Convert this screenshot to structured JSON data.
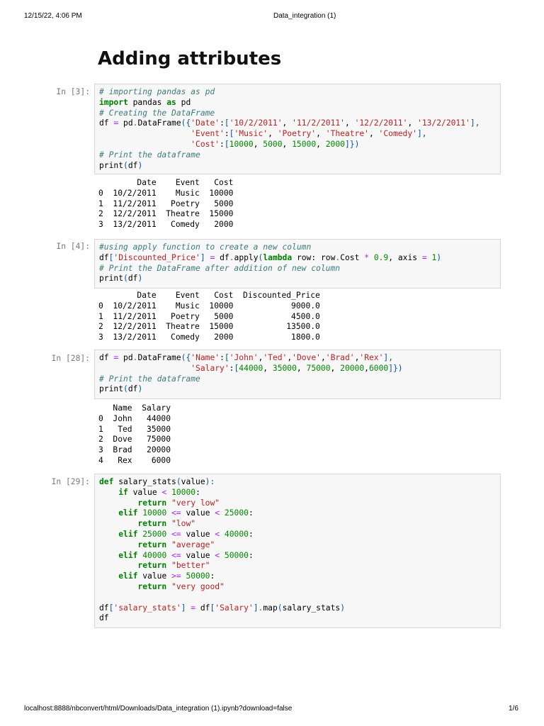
{
  "header": {
    "datetime": "12/15/22, 4:06 PM",
    "title": "Data_integration (1)"
  },
  "footer": {
    "url": "localhost:8888/nbconvert/html/Downloads/Data_integration (1).ipynb?download=false",
    "page": "1/6"
  },
  "heading": "Adding attributes",
  "cells": [
    {
      "prompt": "In [3]:",
      "code": [
        [
          [
            "c",
            "# importing pandas as pd"
          ]
        ],
        [
          [
            "k",
            "import"
          ],
          [
            "",
            " pandas "
          ],
          [
            "k",
            "as"
          ],
          [
            "",
            " pd"
          ]
        ],
        [
          [
            "c",
            "# Creating the DataFrame"
          ]
        ],
        [
          [
            "",
            "df "
          ],
          [
            "o",
            "="
          ],
          [
            "",
            " pd"
          ],
          [
            "o",
            "."
          ],
          [
            "",
            "DataFrame"
          ],
          [
            "p",
            "({"
          ],
          [
            "s",
            "'Date'"
          ],
          [
            "",
            ":"
          ],
          [
            "p",
            "["
          ],
          [
            "s",
            "'10/2/2011'"
          ],
          [
            "",
            ", "
          ],
          [
            "s",
            "'11/2/2011'"
          ],
          [
            "",
            ", "
          ],
          [
            "s",
            "'12/2/2011'"
          ],
          [
            "",
            ", "
          ],
          [
            "s",
            "'13/2/2011'"
          ],
          [
            "p",
            "],"
          ]
        ],
        [
          [
            "",
            "                   "
          ],
          [
            "s",
            "'Event'"
          ],
          [
            "",
            ":"
          ],
          [
            "p",
            "["
          ],
          [
            "s",
            "'Music'"
          ],
          [
            "",
            ", "
          ],
          [
            "s",
            "'Poetry'"
          ],
          [
            "",
            ", "
          ],
          [
            "s",
            "'Theatre'"
          ],
          [
            "",
            ", "
          ],
          [
            "s",
            "'Comedy'"
          ],
          [
            "p",
            "],"
          ]
        ],
        [
          [
            "",
            "                   "
          ],
          [
            "s",
            "'Cost'"
          ],
          [
            "",
            ":"
          ],
          [
            "p",
            "["
          ],
          [
            "n",
            "10000"
          ],
          [
            "",
            ", "
          ],
          [
            "n",
            "5000"
          ],
          [
            "",
            ", "
          ],
          [
            "n",
            "15000"
          ],
          [
            "",
            ", "
          ],
          [
            "n",
            "2000"
          ],
          [
            "p",
            "]})"
          ]
        ],
        [
          [
            "c",
            "# Print the dataframe"
          ]
        ],
        [
          [
            "",
            "print"
          ],
          [
            "p",
            "("
          ],
          [
            "",
            "df"
          ],
          [
            "p",
            ")"
          ]
        ]
      ],
      "output": [
        "        Date    Event   Cost",
        "0  10/2/2011    Music  10000",
        "1  11/2/2011   Poetry   5000",
        "2  12/2/2011  Theatre  15000",
        "3  13/2/2011   Comedy   2000"
      ]
    },
    {
      "prompt": "In [4]:",
      "code": [
        [
          [
            "c",
            "#using apply function to create a new column"
          ]
        ],
        [
          [
            "",
            "df"
          ],
          [
            "p",
            "["
          ],
          [
            "s",
            "'Discounted_Price'"
          ],
          [
            "p",
            "]"
          ],
          [
            "",
            " "
          ],
          [
            "o",
            "="
          ],
          [
            "",
            " df"
          ],
          [
            "o",
            "."
          ],
          [
            "",
            "apply"
          ],
          [
            "p",
            "("
          ],
          [
            "k",
            "lambda"
          ],
          [
            "",
            " row: row"
          ],
          [
            "o",
            "."
          ],
          [
            "",
            "Cost "
          ],
          [
            "o",
            "*"
          ],
          [
            "",
            " "
          ],
          [
            "n",
            "0.9"
          ],
          [
            "",
            ", axis "
          ],
          [
            "o",
            "="
          ],
          [
            "",
            " "
          ],
          [
            "n",
            "1"
          ],
          [
            "p",
            ")"
          ]
        ],
        [
          [
            "c",
            "# Print the DataFrame after addition of new column"
          ]
        ],
        [
          [
            "",
            "print"
          ],
          [
            "p",
            "("
          ],
          [
            "",
            "df"
          ],
          [
            "p",
            ")"
          ]
        ]
      ],
      "output": [
        "        Date    Event   Cost  Discounted_Price",
        "0  10/2/2011    Music  10000            9000.0",
        "1  11/2/2011   Poetry   5000            4500.0",
        "2  12/2/2011  Theatre  15000           13500.0",
        "3  13/2/2011   Comedy   2000            1800.0"
      ]
    },
    {
      "prompt": "In [28]:",
      "code": [
        [
          [
            "",
            "df "
          ],
          [
            "o",
            "="
          ],
          [
            "",
            " pd"
          ],
          [
            "o",
            "."
          ],
          [
            "",
            "DataFrame"
          ],
          [
            "p",
            "({"
          ],
          [
            "s",
            "'Name'"
          ],
          [
            "",
            ":"
          ],
          [
            "p",
            "["
          ],
          [
            "s",
            "'John'"
          ],
          [
            "",
            ","
          ],
          [
            "s",
            "'Ted'"
          ],
          [
            "",
            ","
          ],
          [
            "s",
            "'Dove'"
          ],
          [
            "",
            ","
          ],
          [
            "s",
            "'Brad'"
          ],
          [
            "",
            ","
          ],
          [
            "s",
            "'Rex'"
          ],
          [
            "p",
            "],"
          ]
        ],
        [
          [
            "",
            "                   "
          ],
          [
            "s",
            "'Salary'"
          ],
          [
            "",
            ":"
          ],
          [
            "p",
            "["
          ],
          [
            "n",
            "44000"
          ],
          [
            "",
            ", "
          ],
          [
            "n",
            "35000"
          ],
          [
            "",
            ", "
          ],
          [
            "n",
            "75000"
          ],
          [
            "",
            ", "
          ],
          [
            "n",
            "20000"
          ],
          [
            "",
            ","
          ],
          [
            "n",
            "6000"
          ],
          [
            "p",
            "]})"
          ]
        ],
        [
          [
            "c",
            "# Print the dataframe"
          ]
        ],
        [
          [
            "",
            "print"
          ],
          [
            "p",
            "("
          ],
          [
            "",
            "df"
          ],
          [
            "p",
            ")"
          ]
        ]
      ],
      "output": [
        "   Name  Salary",
        "0  John   44000",
        "1   Ted   35000",
        "2  Dove   75000",
        "3  Brad   20000",
        "4   Rex    6000"
      ]
    },
    {
      "prompt": "In [29]:",
      "code": [
        [
          [
            "k",
            "def"
          ],
          [
            "",
            " salary_stats"
          ],
          [
            "p",
            "("
          ],
          [
            "",
            "value"
          ],
          [
            "p",
            "):"
          ]
        ],
        [
          [
            "",
            "    "
          ],
          [
            "k",
            "if"
          ],
          [
            "",
            " value "
          ],
          [
            "o",
            "<"
          ],
          [
            "",
            " "
          ],
          [
            "n",
            "10000"
          ],
          [
            "",
            ":"
          ]
        ],
        [
          [
            "",
            "        "
          ],
          [
            "k",
            "return"
          ],
          [
            "",
            " "
          ],
          [
            "s",
            "\"very low\""
          ]
        ],
        [
          [
            "",
            "    "
          ],
          [
            "k",
            "elif"
          ],
          [
            "",
            " "
          ],
          [
            "n",
            "10000"
          ],
          [
            "",
            " "
          ],
          [
            "o",
            "<="
          ],
          [
            "",
            " value "
          ],
          [
            "o",
            "<"
          ],
          [
            "",
            " "
          ],
          [
            "n",
            "25000"
          ],
          [
            "",
            ":"
          ]
        ],
        [
          [
            "",
            "        "
          ],
          [
            "k",
            "return"
          ],
          [
            "",
            " "
          ],
          [
            "s",
            "\"low\""
          ]
        ],
        [
          [
            "",
            "    "
          ],
          [
            "k",
            "elif"
          ],
          [
            "",
            " "
          ],
          [
            "n",
            "25000"
          ],
          [
            "",
            " "
          ],
          [
            "o",
            "<="
          ],
          [
            "",
            " value "
          ],
          [
            "o",
            "<"
          ],
          [
            "",
            " "
          ],
          [
            "n",
            "40000"
          ],
          [
            "",
            ":"
          ]
        ],
        [
          [
            "",
            "        "
          ],
          [
            "k",
            "return"
          ],
          [
            "",
            " "
          ],
          [
            "s",
            "\"average\""
          ]
        ],
        [
          [
            "",
            "    "
          ],
          [
            "k",
            "elif"
          ],
          [
            "",
            " "
          ],
          [
            "n",
            "40000"
          ],
          [
            "",
            " "
          ],
          [
            "o",
            "<="
          ],
          [
            "",
            " value "
          ],
          [
            "o",
            "<"
          ],
          [
            "",
            " "
          ],
          [
            "n",
            "50000"
          ],
          [
            "",
            ":"
          ]
        ],
        [
          [
            "",
            "        "
          ],
          [
            "k",
            "return"
          ],
          [
            "",
            " "
          ],
          [
            "s",
            "\"better\""
          ]
        ],
        [
          [
            "",
            "    "
          ],
          [
            "k",
            "elif"
          ],
          [
            "",
            " value "
          ],
          [
            "o",
            ">="
          ],
          [
            "",
            " "
          ],
          [
            "n",
            "50000"
          ],
          [
            "",
            ":"
          ]
        ],
        [
          [
            "",
            "        "
          ],
          [
            "k",
            "return"
          ],
          [
            "",
            " "
          ],
          [
            "s",
            "\"very good\""
          ]
        ],
        [
          [
            "",
            ""
          ]
        ],
        [
          [
            "",
            "df"
          ],
          [
            "p",
            "["
          ],
          [
            "s",
            "'salary_stats'"
          ],
          [
            "p",
            "]"
          ],
          [
            "",
            " "
          ],
          [
            "o",
            "="
          ],
          [
            "",
            " df"
          ],
          [
            "p",
            "["
          ],
          [
            "s",
            "'Salary'"
          ],
          [
            "p",
            "]"
          ],
          [
            "o",
            "."
          ],
          [
            "",
            "map"
          ],
          [
            "p",
            "("
          ],
          [
            "",
            "salary_stats"
          ],
          [
            "p",
            ")"
          ]
        ],
        [
          [
            "",
            "df"
          ]
        ]
      ],
      "output": []
    }
  ]
}
